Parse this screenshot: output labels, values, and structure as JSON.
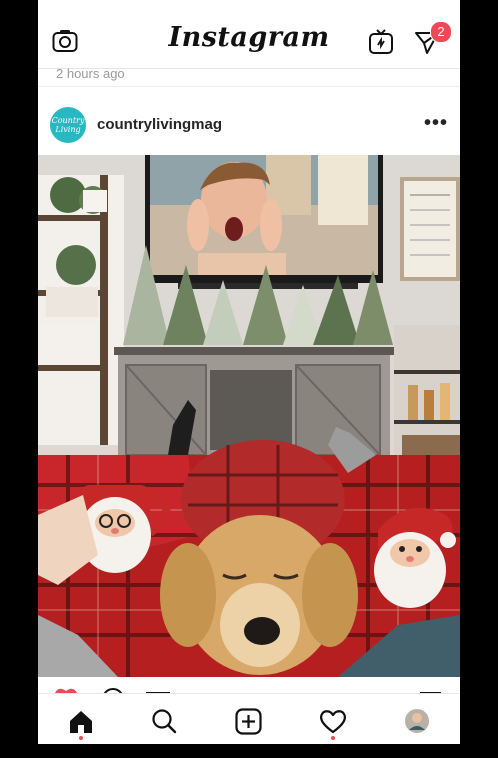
{
  "app": {
    "logo_text": "Instagram"
  },
  "header": {
    "camera_icon": "camera-icon",
    "igtv_icon": "igtv-icon",
    "direct_icon": "direct-message-icon",
    "direct_badge_count": "2"
  },
  "post_previous": {
    "timestamp": "2 hours ago"
  },
  "post": {
    "avatar_text": "Country Living",
    "username": "countrylivingmag",
    "more_icon": "more-options-icon",
    "more_glyph": "•••"
  },
  "nav": {
    "items": [
      {
        "name": "home",
        "icon": "home-icon"
      },
      {
        "name": "search",
        "icon": "search-icon"
      },
      {
        "name": "new-post",
        "icon": "plus-square-icon"
      },
      {
        "name": "activity",
        "icon": "heart-icon"
      },
      {
        "name": "profile",
        "icon": "profile-avatar-icon"
      }
    ]
  },
  "colors": {
    "badge": "#ed4956",
    "avatar": "#27b8c1",
    "text": "#262626",
    "muted": "#9a9a9a"
  }
}
